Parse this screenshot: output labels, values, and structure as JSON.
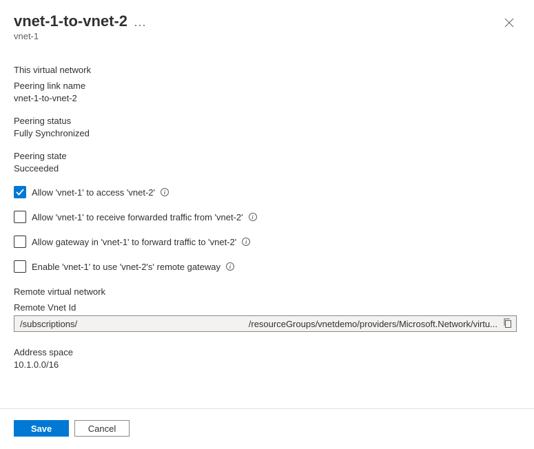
{
  "header": {
    "title": "vnet-1-to-vnet-2",
    "subtitle": "vnet-1"
  },
  "section_this": {
    "heading": "This virtual network",
    "link_name_label": "Peering link name",
    "link_name_value": "vnet-1-to-vnet-2",
    "status_label": "Peering status",
    "status_value": "Fully Synchronized",
    "state_label": "Peering state",
    "state_value": "Succeeded"
  },
  "checkboxes": {
    "allow_access": {
      "label": "Allow 'vnet-1' to access 'vnet-2'",
      "checked": true
    },
    "allow_forwarded": {
      "label": "Allow 'vnet-1' to receive forwarded traffic from 'vnet-2'",
      "checked": false
    },
    "allow_gateway_forward": {
      "label": "Allow gateway in 'vnet-1' to forward traffic to 'vnet-2'",
      "checked": false
    },
    "enable_remote_gateway": {
      "label": "Enable 'vnet-1' to use 'vnet-2's' remote gateway",
      "checked": false
    }
  },
  "section_remote": {
    "heading": "Remote virtual network",
    "remote_id_label": "Remote Vnet Id",
    "remote_id_left": "/subscriptions/",
    "remote_id_right": "/resourceGroups/vnetdemo/providers/Microsoft.Network/virtu...",
    "address_label": "Address space",
    "address_value": "10.1.0.0/16"
  },
  "buttons": {
    "save": "Save",
    "cancel": "Cancel"
  }
}
